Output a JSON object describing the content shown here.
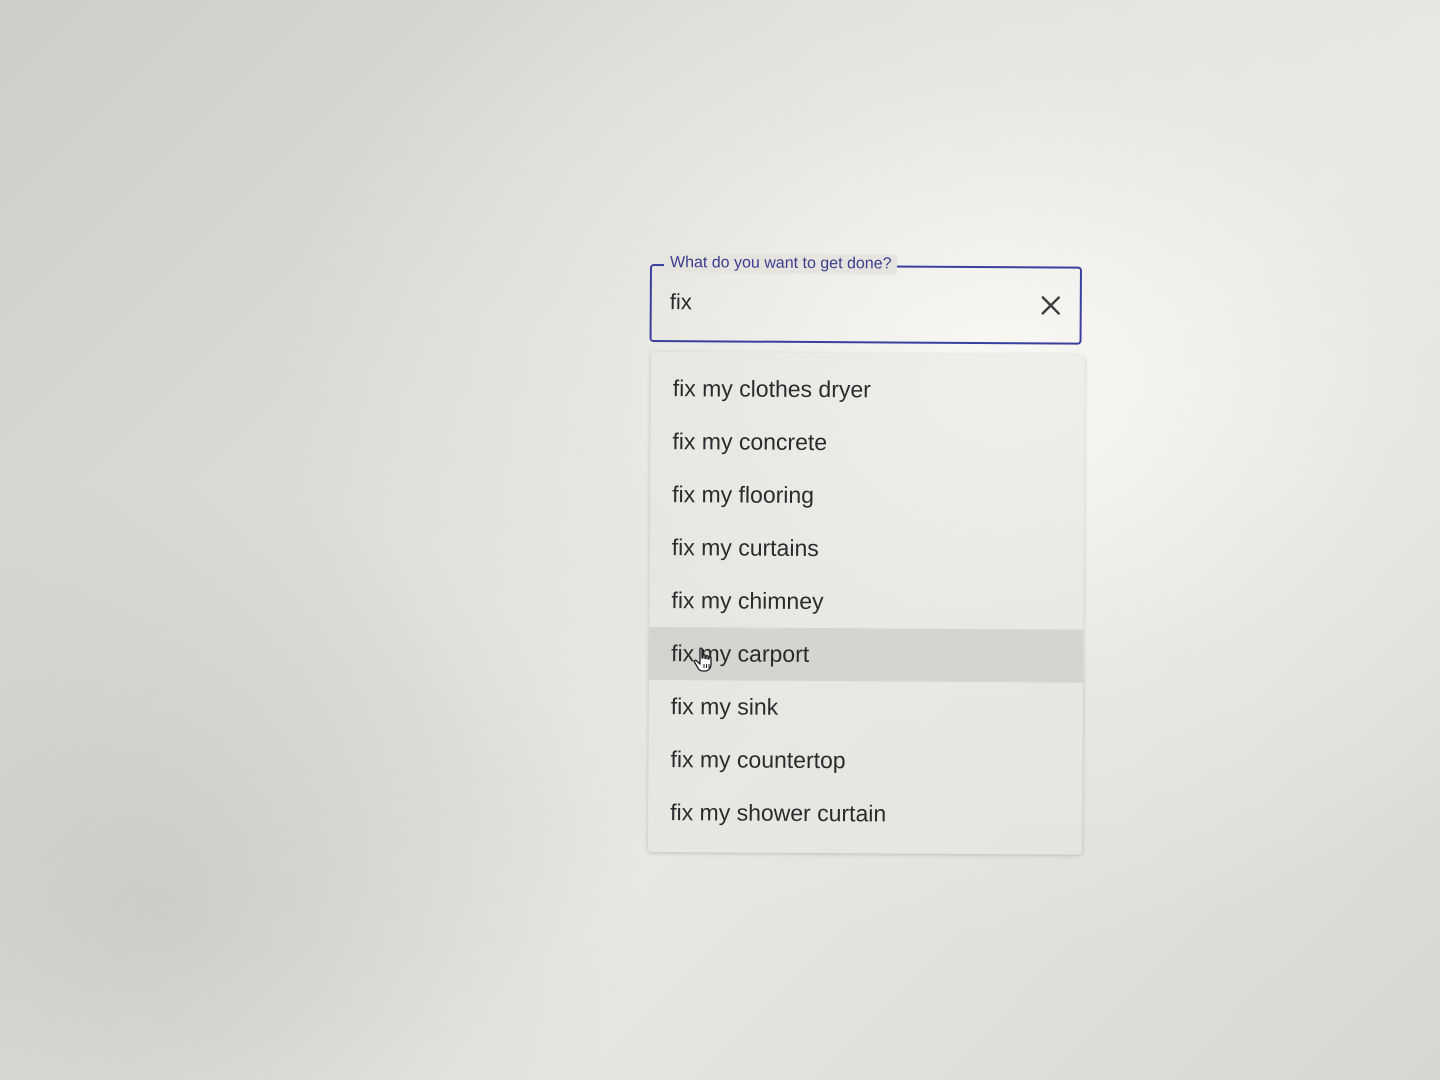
{
  "search": {
    "label": "What do you want to get done?",
    "value": "fix",
    "clear_icon": "close-icon"
  },
  "suggestions": [
    {
      "label": "fix my clothes dryer"
    },
    {
      "label": "fix my concrete"
    },
    {
      "label": "fix my flooring"
    },
    {
      "label": "fix my curtains"
    },
    {
      "label": "fix my chimney"
    },
    {
      "label": "fix my carport",
      "hovered": true
    },
    {
      "label": "fix my sink"
    },
    {
      "label": "fix my countertop"
    },
    {
      "label": "fix my shower curtain"
    }
  ],
  "colors": {
    "accent": "#3b3f9e",
    "label": "#3a3d8c",
    "text": "#2b2b2b",
    "hover": "#c9c7c2"
  },
  "cursor_icon": "hand-pointer-icon"
}
